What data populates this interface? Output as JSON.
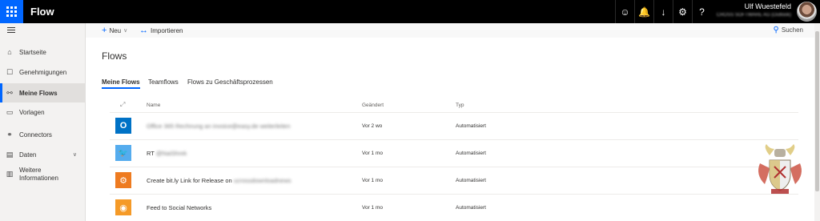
{
  "topbar": {
    "app_title": "Flow",
    "icons": [
      "smiley-icon",
      "bell-icon",
      "download-icon",
      "gear-icon",
      "help-icon"
    ],
    "icon_glyphs": [
      "☺",
      "🔔",
      "↓",
      "⚙",
      "?"
    ],
    "user_name": "Ulf Wuestefeld",
    "user_org": "CROSS SOFTWARE AG (Outlook)",
    "accent_color": "#0066ff"
  },
  "nav": {
    "items": [
      {
        "label": "Startseite",
        "icon": "home-icon",
        "glyph": "⌂"
      },
      {
        "label": "Genehmigungen",
        "icon": "approvals-icon",
        "glyph": "☐"
      },
      {
        "label": "Meine Flows",
        "icon": "flows-icon",
        "glyph": "⚯",
        "active": true
      },
      {
        "label": "Vorlagen",
        "icon": "templates-icon",
        "glyph": "▭"
      },
      {
        "label": "Connectors",
        "icon": "connectors-icon",
        "glyph": "⚭"
      },
      {
        "label": "Daten",
        "icon": "data-icon",
        "glyph": "▤"
      },
      {
        "label": "Weitere Informationen",
        "icon": "book-icon",
        "glyph": "▥"
      }
    ]
  },
  "commands": {
    "new_label": "Neu",
    "import_label": "Importieren",
    "search_label": "Suchen"
  },
  "main": {
    "title": "Flows",
    "tabs": [
      "Meine Flows",
      "Teamflows",
      "Flows zu Geschäftsprozessen"
    ],
    "columns": {
      "name": "Name",
      "modified": "Geändert",
      "type": "Typ"
    },
    "rows": [
      {
        "icon": "outlook-icon",
        "color": "#0072c6",
        "glyph": "O",
        "name_plain": "",
        "name_blurred": "Office 365 Rechnung an invoice@easy.de weiterleiten",
        "modified": "Vor 2 wo",
        "type": "Automatisiert"
      },
      {
        "icon": "twitter-icon",
        "color": "#55acee",
        "glyph": "🐦",
        "name_plain": "RT ",
        "name_blurred": "@NaiShrek",
        "modified": "Vor 1 mo",
        "type": "Automatisiert"
      },
      {
        "icon": "bitly-icon",
        "color": "#ee7b20",
        "glyph": "⚙",
        "name_plain": "Create bit.ly Link for Release on ",
        "name_blurred": "ucrossdownloadnews",
        "modified": "Vor 1 mo",
        "type": "Automatisiert"
      },
      {
        "icon": "rss-icon",
        "color": "#f59a27",
        "glyph": "◉",
        "name_plain": "Feed to Social Networks",
        "name_blurred": "",
        "modified": "Vor 1 mo",
        "type": "Automatisiert"
      }
    ]
  }
}
